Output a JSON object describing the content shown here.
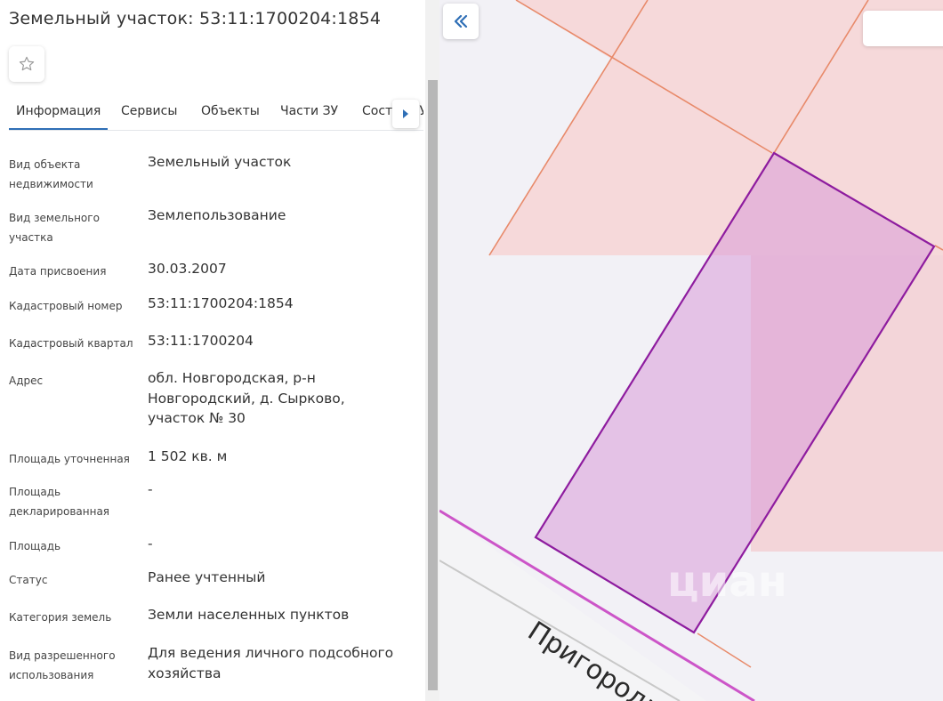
{
  "header": {
    "title": "Земельный участок: 53:11:1700204:1854"
  },
  "favorite": {
    "icon": "star-outline-icon"
  },
  "tabs": [
    {
      "label": "Информация",
      "active": true
    },
    {
      "label": "Сервисы",
      "active": false
    },
    {
      "label": "Объекты",
      "active": false
    },
    {
      "label": "Части ЗУ",
      "active": false
    },
    {
      "label": "Состав ЗУ",
      "active": false
    }
  ],
  "tab_scroll_icon": "caret-right-icon",
  "properties": [
    {
      "label": "Вид объекта недвижимости",
      "value": "Земельный участок"
    },
    {
      "label": "Вид земельного участка",
      "value": "Землепользование"
    },
    {
      "label": "Дата присвоения",
      "value": "30.03.2007"
    },
    {
      "label": "Кадастровый номер",
      "value": "53:11:1700204:1854"
    },
    {
      "label": "Кадастровый квартал",
      "value": "53:11:1700204"
    },
    {
      "label": "Адрес",
      "value": "обл. Новгородская, р-н Новгородский, д. Сырково, участок № 30"
    },
    {
      "label": "Площадь уточненная",
      "value": "1 502 кв. м"
    },
    {
      "label": "Площадь декларированная",
      "value": "-"
    },
    {
      "label": "Площадь",
      "value": "-"
    },
    {
      "label": "Статус",
      "value": "Ранее учтенный"
    },
    {
      "label": "Категория земель",
      "value": "Земли населенных пунктов"
    },
    {
      "label": "Вид разрешенного использования",
      "value": "Для ведения личного подсобного хозяйства"
    }
  ],
  "map": {
    "collapse_icon": "double-chevron-left-icon",
    "street_label": "Пригородн",
    "watermark": "циан",
    "colors": {
      "parcel_outline": "#8e1c9f",
      "parcel_fill": "#d89ad8",
      "neighbor_fill": "#f6d9da",
      "neighbor_line": "#e88a6a",
      "road_line": "#cc55c8"
    }
  }
}
